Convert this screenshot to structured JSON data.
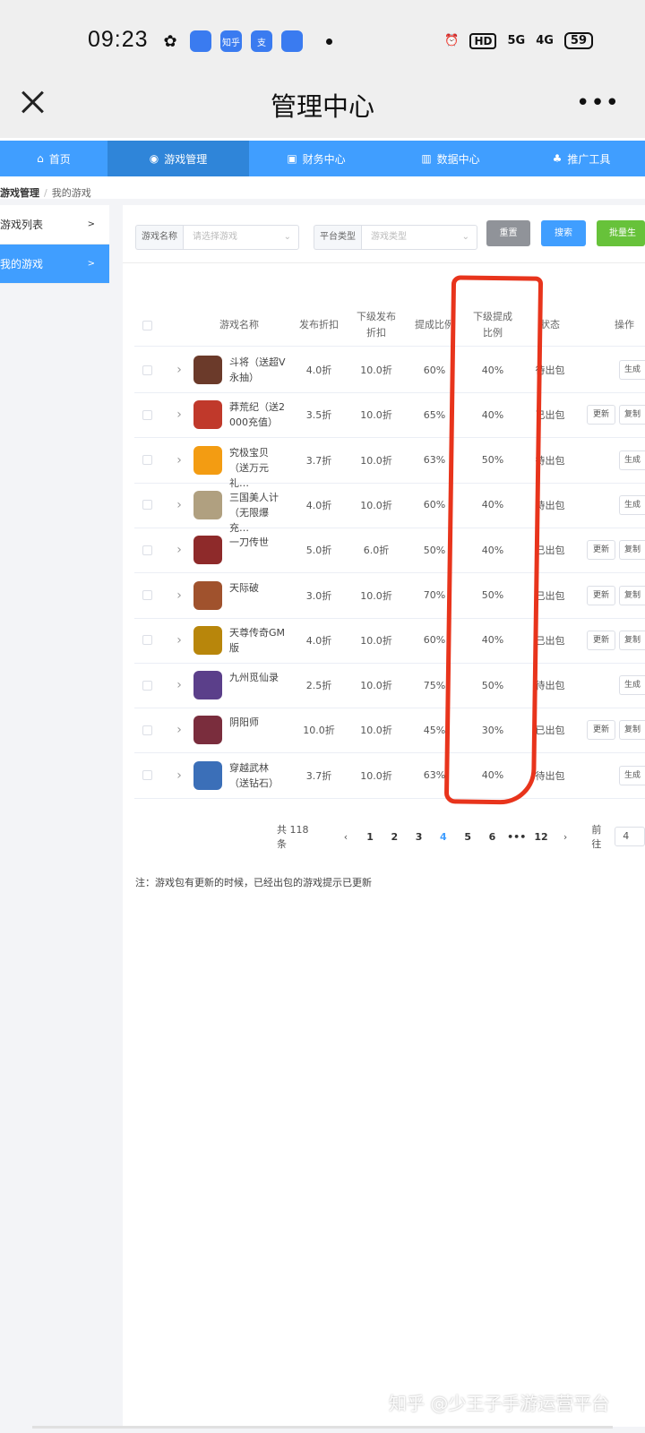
{
  "status_bar": {
    "time": "09:23",
    "apps": [
      "wechat-icon",
      "app-icon",
      "知乎",
      "支",
      "app-icon-2"
    ],
    "hd": "HD",
    "net1": "5G",
    "net2": "4G",
    "battery": "59"
  },
  "titlebar": {
    "title": "管理中心",
    "more": "•••"
  },
  "nav": [
    {
      "label": "首页",
      "icon": "⌂"
    },
    {
      "label": "游戏管理",
      "icon": "◉"
    },
    {
      "label": "财务中心",
      "icon": "▣"
    },
    {
      "label": "数据中心",
      "icon": "▥"
    },
    {
      "label": "推广工具",
      "icon": "♣"
    }
  ],
  "breadcrumb": {
    "first": "游戏管理",
    "separator": "/",
    "second": "我的游戏"
  },
  "sidebar": [
    {
      "label": "游戏列表",
      "arrow": ">"
    },
    {
      "label": "我的游戏",
      "arrow": ">"
    }
  ],
  "filters": {
    "game_name_label": "游戏名称",
    "game_name_placeholder": "请选择游戏",
    "platform_label": "平台类型",
    "platform_placeholder": "游戏类型",
    "reset": "重置",
    "search": "搜索",
    "batch": "批量生"
  },
  "table": {
    "headers": {
      "name": "游戏名称",
      "discount": "发布折扣",
      "sub_discount_l1": "下级发布",
      "sub_discount_l2": "折扣",
      "commission": "提成比例",
      "sub_commission_l1": "下级提成",
      "sub_commission_l2": "比例",
      "status": "状态",
      "ops": "操作"
    },
    "rows": [
      {
        "name_l1": "斗将（送超V",
        "name_l2": "永抽）",
        "discount": "4.0折",
        "sub_discount": "10.0折",
        "commission": "60%",
        "sub_commission": "40%",
        "status": "待出包",
        "update": "",
        "gen": "生成"
      },
      {
        "name_l1": "莽荒纪（送2",
        "name_l2": "000充值）",
        "discount": "3.5折",
        "sub_discount": "10.0折",
        "commission": "65%",
        "sub_commission": "40%",
        "status": "已出包",
        "update": "更新",
        "gen": "复制"
      },
      {
        "name_l1": "究极宝贝",
        "name_l2": "（送万元礼…",
        "discount": "3.7折",
        "sub_discount": "10.0折",
        "commission": "63%",
        "sub_commission": "50%",
        "status": "待出包",
        "update": "",
        "gen": "生成"
      },
      {
        "name_l1": "三国美人计",
        "name_l2": "（无限爆充…",
        "discount": "4.0折",
        "sub_discount": "10.0折",
        "commission": "60%",
        "sub_commission": "40%",
        "status": "待出包",
        "update": "",
        "gen": "生成"
      },
      {
        "name_l1": "一刀传世",
        "name_l2": "",
        "discount": "5.0折",
        "sub_discount": "6.0折",
        "commission": "50%",
        "sub_commission": "40%",
        "status": "已出包",
        "update": "更新",
        "gen": "复制"
      },
      {
        "name_l1": "天际破",
        "name_l2": "",
        "discount": "3.0折",
        "sub_discount": "10.0折",
        "commission": "70%",
        "sub_commission": "50%",
        "status": "已出包",
        "update": "更新",
        "gen": "复制"
      },
      {
        "name_l1": "天尊传奇GM",
        "name_l2": "版",
        "discount": "4.0折",
        "sub_discount": "10.0折",
        "commission": "60%",
        "sub_commission": "40%",
        "status": "已出包",
        "update": "更新",
        "gen": "复制"
      },
      {
        "name_l1": "九州觅仙录",
        "name_l2": "",
        "discount": "2.5折",
        "sub_discount": "10.0折",
        "commission": "75%",
        "sub_commission": "50%",
        "status": "待出包",
        "update": "",
        "gen": "生成"
      },
      {
        "name_l1": "阴阳师",
        "name_l2": "",
        "discount": "10.0折",
        "sub_discount": "10.0折",
        "commission": "45%",
        "sub_commission": "30%",
        "status": "已出包",
        "update": "更新",
        "gen": "复制"
      },
      {
        "name_l1": "穿越武林",
        "name_l2": "（送钻石）",
        "discount": "3.7折",
        "sub_discount": "10.0折",
        "commission": "63%",
        "sub_commission": "40%",
        "status": "待出包",
        "update": "",
        "gen": "生成"
      }
    ],
    "icon_colors": [
      "#6b3a2a",
      "#c0392b",
      "#f39c12",
      "#b0a080",
      "#8e2a2a",
      "#a0522d",
      "#b8860b",
      "#5b3f8a",
      "#7a2d3d",
      "#3b6fb8"
    ]
  },
  "pagination": {
    "total": "共 118 条",
    "prev": "‹",
    "pages": [
      "1",
      "2",
      "3",
      "4",
      "5",
      "6",
      "•••",
      "12"
    ],
    "next": "›",
    "goto_label": "前往",
    "goto_value": "4"
  },
  "note": "注：游戏包有更新的时候，已经出包的游戏提示已更新",
  "watermark": "知乎 @少王子手游运营平台",
  "colors": {
    "primary": "#409eff",
    "annotation": "#e8341c",
    "success": "#67c23a",
    "info": "#909399"
  }
}
